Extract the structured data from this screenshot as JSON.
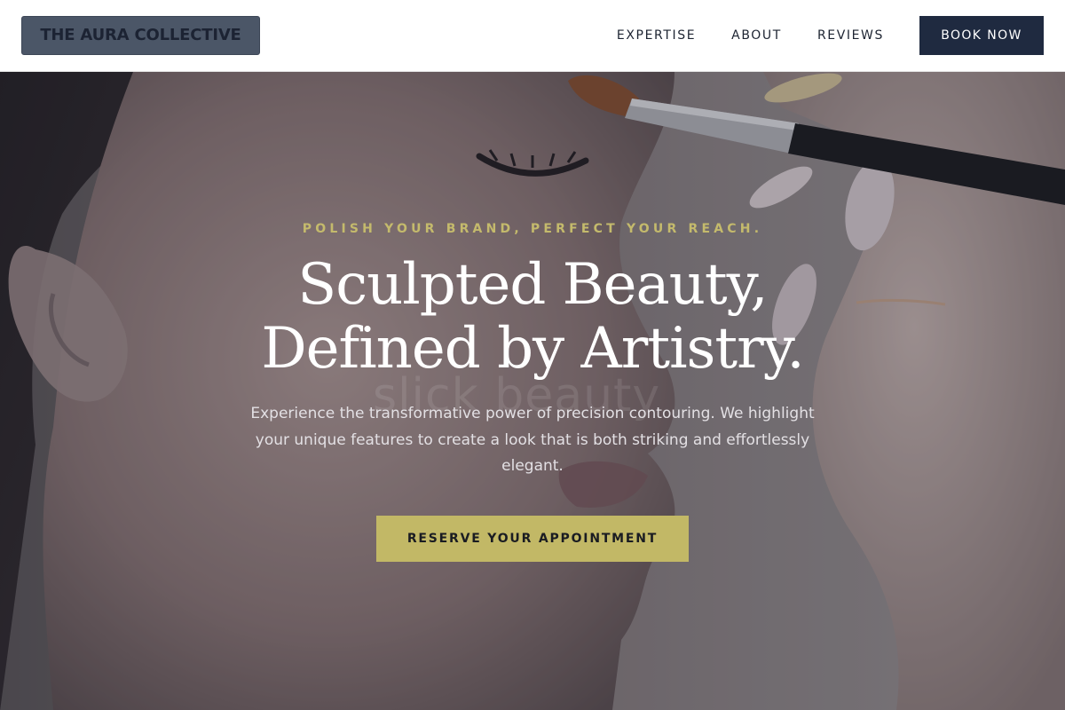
{
  "header": {
    "logo_text": "THE AURA COLLECTIVE",
    "nav": [
      {
        "label": "EXPERTISE"
      },
      {
        "label": "ABOUT"
      },
      {
        "label": "REVIEWS"
      }
    ],
    "book_label": "BOOK NOW"
  },
  "hero": {
    "eyebrow": "POLISH YOUR BRAND, PERFECT YOUR REACH.",
    "headline_line1": "Sculpted Beauty,",
    "headline_line2": "Defined by Artistry.",
    "description": "Experience the transformative power of precision contouring. We highlight your unique features to create a look that is both striking and effortlessly elegant.",
    "cta_label": "RESERVE YOUR APPOINTMENT",
    "watermark_text": "slick beauty"
  },
  "colors": {
    "header_bg": "#ffffff",
    "logo_bg": "#4b5667",
    "nav_text": "#1d2432",
    "book_bg": "#1f2a40",
    "accent_gold": "#c2b866",
    "headline_text": "#ffffff",
    "description_text": "#e3e0e4"
  }
}
